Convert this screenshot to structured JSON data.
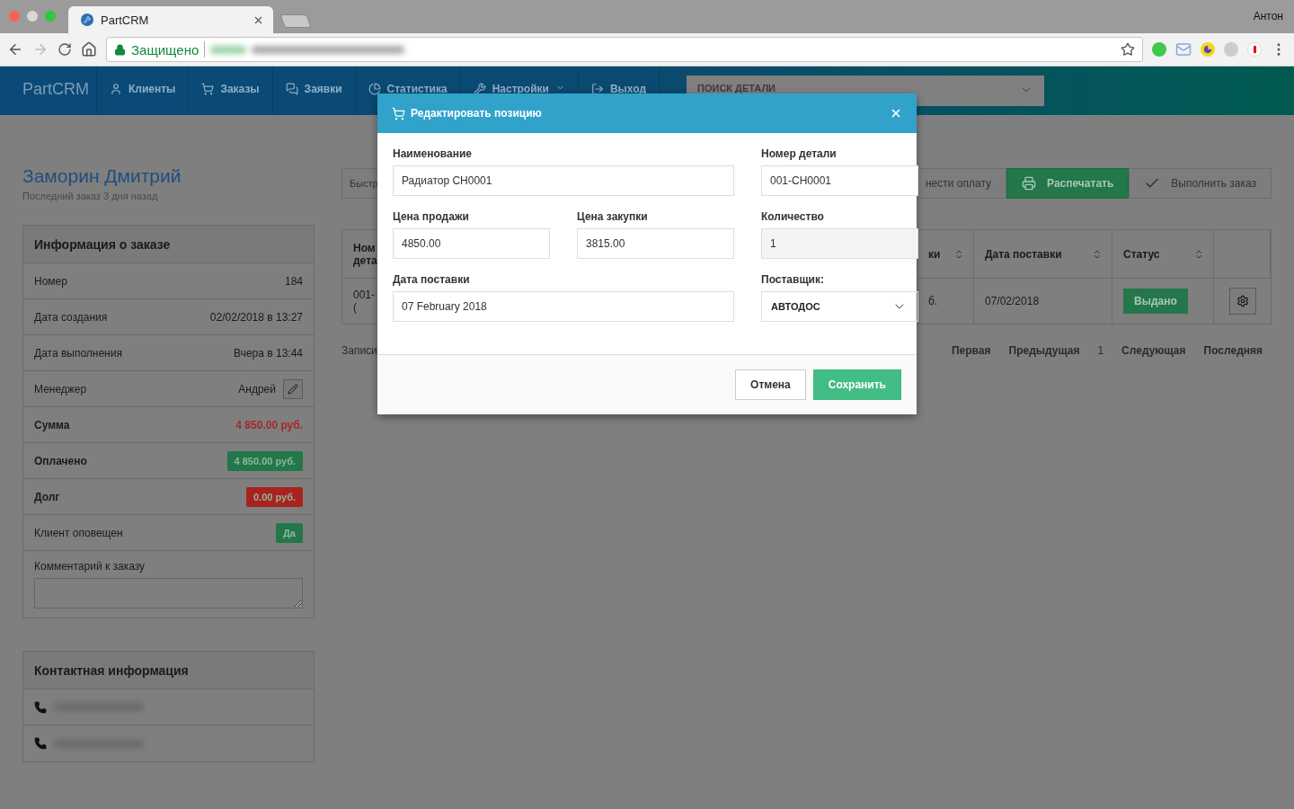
{
  "browser": {
    "tab_title": "PartCRM",
    "profile": "Антон",
    "security": "Защищено"
  },
  "nav": {
    "brand": "PartCRM",
    "items": [
      {
        "label": "Клиенты",
        "dropdown": false
      },
      {
        "label": "Заказы",
        "dropdown": false
      },
      {
        "label": "Заявки",
        "dropdown": false
      },
      {
        "label": "Статистика",
        "dropdown": false
      },
      {
        "label": "Настройки",
        "dropdown": true
      },
      {
        "label": "Выход",
        "dropdown": false
      }
    ],
    "search": {
      "placeholder": "ПОИСК ДЕТАЛИ"
    }
  },
  "customer": {
    "name": "Заморин Дмитрий",
    "subtitle": "Последний заказ 3 дня назад"
  },
  "order_info": {
    "title": "Информация о заказе",
    "rows": [
      {
        "label": "Номер",
        "value": "184",
        "kind": "text",
        "bold": false
      },
      {
        "label": "Дата создания",
        "value": "02/02/2018 в 13:27",
        "kind": "text",
        "bold": false
      },
      {
        "label": "Дата выполнения",
        "value": "Вчера в 13:44",
        "kind": "text",
        "bold": false
      },
      {
        "label": "Менеджер",
        "value": "Андрей",
        "kind": "edit",
        "bold": false
      },
      {
        "label": "Сумма",
        "value": "4 850.00 руб.",
        "kind": "amount",
        "bold": true,
        "color": "#a42a26"
      },
      {
        "label": "Оплачено",
        "value": "4 850.00 руб.",
        "kind": "badge",
        "bold": true,
        "color": "#23774a"
      },
      {
        "label": "Долг",
        "value": "0.00 руб.",
        "kind": "badge",
        "bold": true,
        "color": "#a8221f"
      },
      {
        "label": "Клиент оповещен",
        "value": "Да",
        "kind": "badge",
        "bold": false,
        "color": "#23774a"
      }
    ],
    "comment": {
      "label": "Комментарий к заказу"
    }
  },
  "contacts": {
    "title": "Контактная информация",
    "rows": [
      {
        "kind": "phone"
      },
      {
        "kind": "phone"
      }
    ]
  },
  "toolbar": {
    "left_fragment": "Быстр",
    "buttons": [
      {
        "label": "нести оплату",
        "kind": "default"
      },
      {
        "label": "Распечатать",
        "kind": "success"
      },
      {
        "label": "Выполнить заказ",
        "kind": "check"
      }
    ]
  },
  "table": {
    "columns": [
      {
        "label": "Ном дета"
      },
      {
        "label": "ки",
        "sortable": true
      },
      {
        "label": "Дата поставки",
        "sortable": true
      },
      {
        "label": "Статус",
        "sortable": true
      }
    ],
    "rows": [
      {
        "cells": [
          "001-(",
          "б.",
          "07/02/2018"
        ],
        "status": "Выдано"
      }
    ]
  },
  "pagination": {
    "info": "Записи",
    "pages": [
      {
        "label": "Первая",
        "selected": false
      },
      {
        "label": "Предыдущая",
        "selected": false
      },
      {
        "label": "1",
        "selected": true
      },
      {
        "label": "Следующая",
        "selected": false
      },
      {
        "label": "Последняя",
        "selected": false
      }
    ]
  },
  "modal": {
    "title": "Редактировать позицию",
    "rows": [
      [
        {
          "label": "Наименование",
          "value": "Радиатор CH0001",
          "kind": "input"
        },
        {
          "label": "Номер детали",
          "value": "001-CH0001",
          "kind": "input"
        }
      ],
      [
        {
          "label": "Цена продажи",
          "value": "4850.00",
          "kind": "input"
        },
        {
          "label": "Цена закупки",
          "value": "3815.00",
          "kind": "input"
        },
        {
          "label": "Количество",
          "value": "1",
          "kind": "readonly"
        }
      ],
      [
        {
          "label": "Дата поставки",
          "value": "07 February 2018",
          "kind": "input"
        },
        {
          "label": "Поставщик:",
          "value": "АВТОДОС",
          "kind": "select"
        }
      ]
    ],
    "cancel": "Отмена",
    "save": "Сохранить"
  }
}
